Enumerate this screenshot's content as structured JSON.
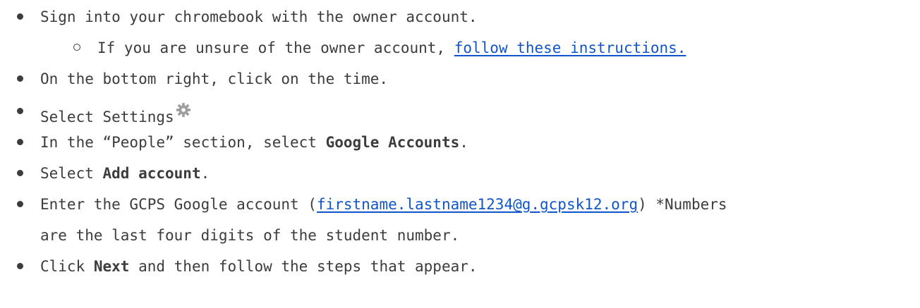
{
  "steps": [
    {
      "text": "Sign into your chromebook with the owner account."
    },
    {
      "prefix": "If you are unsure of the owner account, ",
      "link": "follow these instructions."
    },
    {
      "text": "On the bottom right, click on the time."
    },
    {
      "text": "Select Settings",
      "icon": "gear-icon"
    },
    {
      "prefix": "In the “People” section, select ",
      "bold": "Google Accounts",
      "suffix": "."
    },
    {
      "prefix": "Select ",
      "bold": "Add account",
      "suffix": "."
    },
    {
      "prefix": "Enter the GCPS Google account (",
      "link": "firstname.lastname1234@g.gcpsk12.org",
      "suffix": ") *Numbers",
      "line2": "are the last four digits of the student number."
    },
    {
      "prefix": "Click ",
      "bold": "Next",
      "suffix": " and then follow the steps that appear."
    }
  ],
  "colors": {
    "text": "#3c3c3c",
    "link": "#1155cc",
    "icon": "#9e9e9e"
  }
}
